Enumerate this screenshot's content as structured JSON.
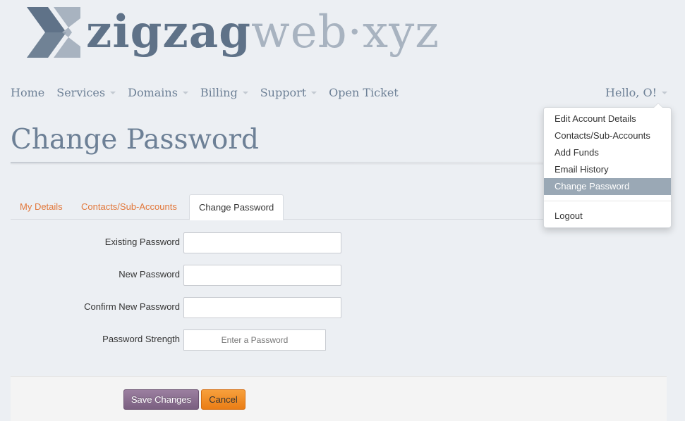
{
  "logo": {
    "part1": "zigzag",
    "part2": "web·xyz"
  },
  "nav": {
    "items": [
      {
        "label": "Home",
        "has_caret": false
      },
      {
        "label": "Services",
        "has_caret": true
      },
      {
        "label": "Domains",
        "has_caret": true
      },
      {
        "label": "Billing",
        "has_caret": true
      },
      {
        "label": "Support",
        "has_caret": true
      },
      {
        "label": "Open Ticket",
        "has_caret": false
      }
    ],
    "user_menu": "Hello, O!"
  },
  "page_title": "Change Password",
  "tabs": [
    {
      "label": "My Details",
      "active": false
    },
    {
      "label": "Contacts/Sub-Accounts",
      "active": false
    },
    {
      "label": "Change Password",
      "active": true
    }
  ],
  "form": {
    "existing_password_label": "Existing Password",
    "existing_password_value": "",
    "new_password_label": "New Password",
    "new_password_value": "",
    "confirm_password_label": "Confirm New Password",
    "confirm_password_value": "",
    "strength_label": "Password Strength",
    "strength_text": "Enter a Password"
  },
  "buttons": {
    "save": "Save Changes",
    "cancel": "Cancel"
  },
  "dropdown": {
    "items": [
      {
        "label": "Edit Account Details",
        "active": false
      },
      {
        "label": "Contacts/Sub-Accounts",
        "active": false
      },
      {
        "label": "Add Funds",
        "active": false
      },
      {
        "label": "Email History",
        "active": false
      },
      {
        "label": "Change Password",
        "active": true
      },
      {
        "label": "Logout",
        "active": false
      }
    ]
  },
  "colors": {
    "accent_orange": "#e2773a",
    "nav_text": "#6d8096",
    "save_button": "#8a6e90",
    "cancel_button": "#f2902a",
    "dropdown_active": "#9aa8b5"
  }
}
